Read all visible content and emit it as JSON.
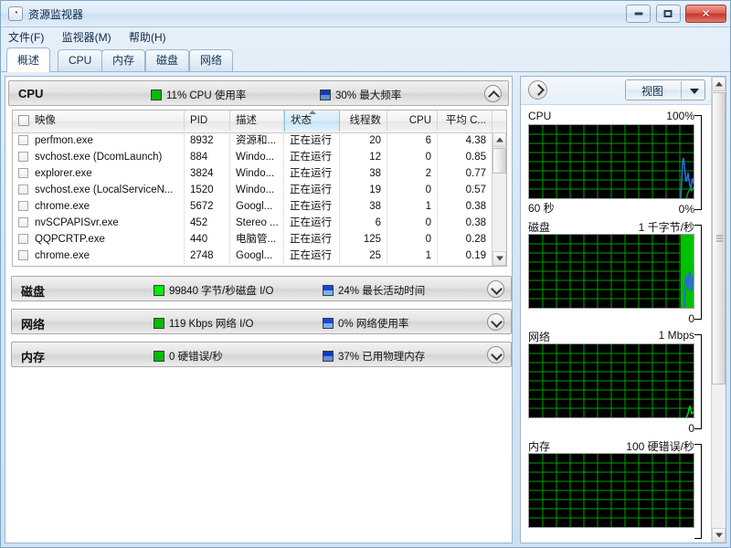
{
  "window": {
    "title": "资源监视器",
    "icon": "resource-monitor-icon",
    "controls": {
      "minimize": "–",
      "maximize": "□",
      "close": "✕"
    }
  },
  "menu": {
    "items": [
      "文件(F)",
      "监视器(M)",
      "帮助(H)"
    ]
  },
  "tabs": [
    {
      "label": "概述",
      "active": true
    },
    {
      "label": "CPU",
      "active": false
    },
    {
      "label": "内存",
      "active": false
    },
    {
      "label": "磁盘",
      "active": false
    },
    {
      "label": "网络",
      "active": false
    }
  ],
  "sections": {
    "cpu": {
      "title": "CPU",
      "stat1": "11% CPU 使用率",
      "stat2": "30% 最大频率",
      "expanded": true,
      "chevron": "chevron-up-icon"
    },
    "disk": {
      "title": "磁盘",
      "stat1": "99840 字节/秒磁盘 I/O",
      "stat2": "24% 最长活动时间",
      "expanded": false,
      "chevron": "chevron-down-icon"
    },
    "network": {
      "title": "网络",
      "stat1": "119 Kbps 网络 I/O",
      "stat2": "0% 网络使用率",
      "expanded": false,
      "chevron": "chevron-down-icon"
    },
    "memory": {
      "title": "内存",
      "stat1": "0 硬错误/秒",
      "stat2": "37% 已用物理内存",
      "expanded": false,
      "chevron": "chevron-down-icon"
    }
  },
  "process_table": {
    "columns": [
      {
        "label": "映像",
        "key": "image",
        "align": "left",
        "sorted": false
      },
      {
        "label": "PID",
        "key": "pid",
        "align": "left",
        "sorted": false
      },
      {
        "label": "描述",
        "key": "description",
        "align": "left",
        "sorted": false
      },
      {
        "label": "状态",
        "key": "status",
        "align": "left",
        "sorted": true,
        "sort_dir": "asc"
      },
      {
        "label": "线程数",
        "key": "threads",
        "align": "right",
        "sorted": false
      },
      {
        "label": "CPU",
        "key": "cpu",
        "align": "right",
        "sorted": false
      },
      {
        "label": "平均 C...",
        "key": "avg_cpu",
        "align": "right",
        "sorted": false
      }
    ],
    "rows": [
      {
        "image": "perfmon.exe",
        "pid": "8932",
        "description": "资源和...",
        "status": "正在运行",
        "threads": "20",
        "cpu": "6",
        "avg_cpu": "4.38"
      },
      {
        "image": "svchost.exe (DcomLaunch)",
        "pid": "884",
        "description": "Windo...",
        "status": "正在运行",
        "threads": "12",
        "cpu": "0",
        "avg_cpu": "0.85"
      },
      {
        "image": "explorer.exe",
        "pid": "3824",
        "description": "Windo...",
        "status": "正在运行",
        "threads": "38",
        "cpu": "2",
        "avg_cpu": "0.77"
      },
      {
        "image": "svchost.exe (LocalServiceN...",
        "pid": "1520",
        "description": "Windo...",
        "status": "正在运行",
        "threads": "19",
        "cpu": "0",
        "avg_cpu": "0.57"
      },
      {
        "image": "chrome.exe",
        "pid": "5672",
        "description": "Googl...",
        "status": "正在运行",
        "threads": "38",
        "cpu": "1",
        "avg_cpu": "0.38"
      },
      {
        "image": "nvSCPAPISvr.exe",
        "pid": "452",
        "description": "Stereo ...",
        "status": "正在运行",
        "threads": "6",
        "cpu": "0",
        "avg_cpu": "0.38"
      },
      {
        "image": "QQPCRTP.exe",
        "pid": "440",
        "description": "电脑管...",
        "status": "正在运行",
        "threads": "125",
        "cpu": "0",
        "avg_cpu": "0.28"
      },
      {
        "image": "chrome.exe",
        "pid": "2748",
        "description": "Googl...",
        "status": "正在运行",
        "threads": "25",
        "cpu": "1",
        "avg_cpu": "0.19"
      }
    ]
  },
  "right_panel": {
    "expand_icon": "chevron-right-icon",
    "view_button": {
      "label": "视图",
      "dropdown_icon": "chevron-down-icon"
    },
    "graphs": [
      {
        "label": "CPU",
        "max": "100%",
        "min": "0%",
        "bottom_left": "60 秒",
        "trace_color": "#2a6bd8"
      },
      {
        "label": "磁盘",
        "max": "1 千字节/秒",
        "min": "0",
        "bottom_left": "",
        "trace_color": "#2a6bd8"
      },
      {
        "label": "网络",
        "max": "1 Mbps",
        "min": "0",
        "bottom_left": "",
        "trace_color": "#00d000"
      },
      {
        "label": "内存",
        "max": "100 硬错误/秒",
        "min": "",
        "bottom_left": "",
        "trace_color": "#00d000"
      }
    ]
  },
  "colors": {
    "graph_background": "#000000",
    "graph_grid": "#00a000",
    "cpu_swatch": "#00e000",
    "freq_swatch": "#1a46d8",
    "accent": "#2a6bd8"
  }
}
